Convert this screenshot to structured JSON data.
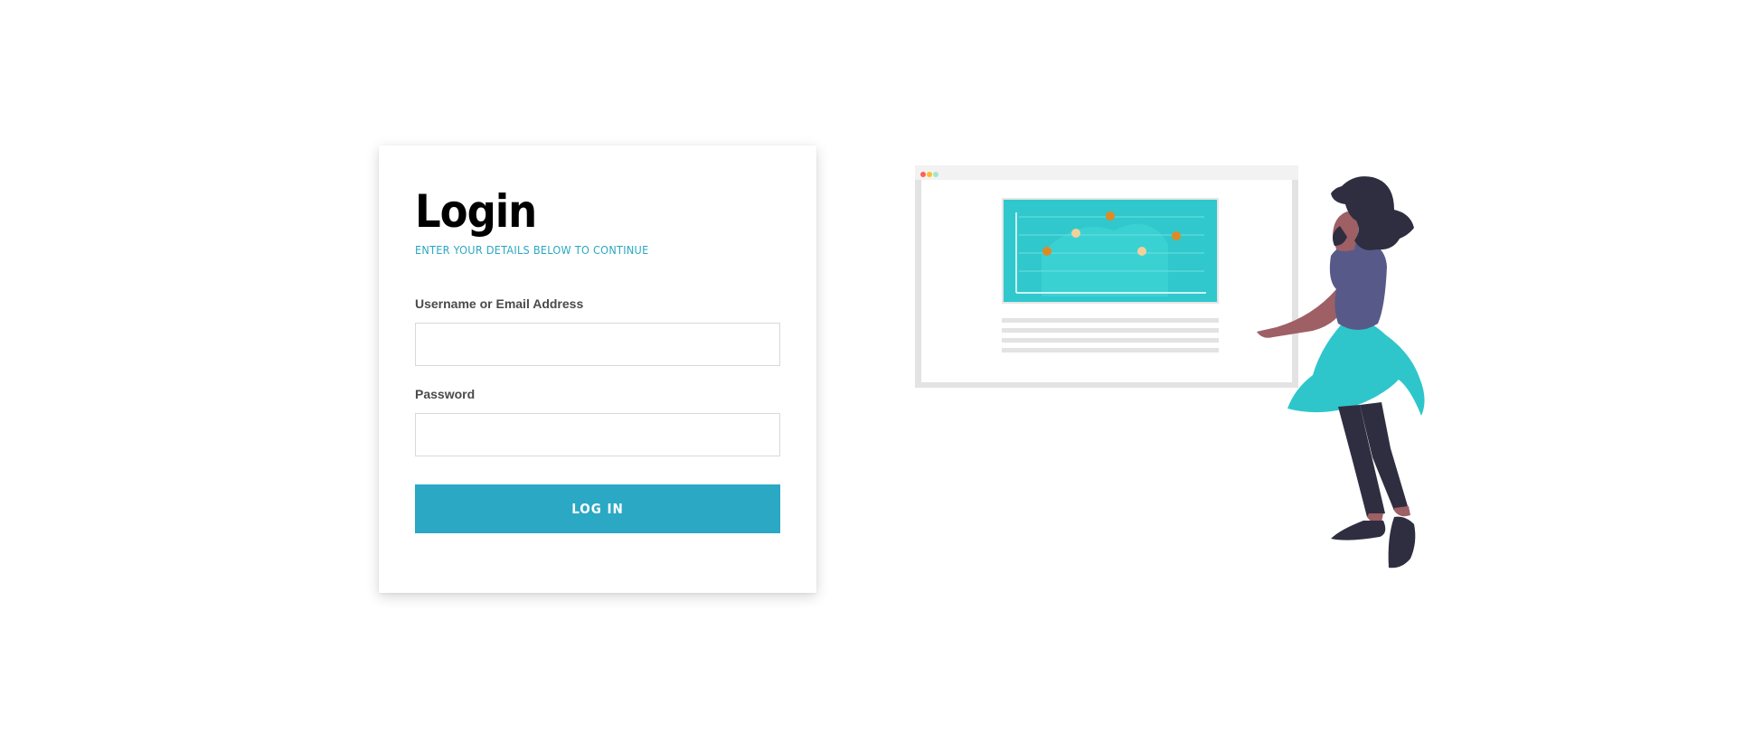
{
  "login": {
    "title": "Login",
    "subtitle": "ENTER YOUR DETAILS BELOW TO CONTINUE",
    "username_label": "Username or Email Address",
    "username_value": "",
    "password_label": "Password",
    "password_value": "",
    "submit_label": "LOG IN"
  },
  "colors": {
    "accent": "#2aa8c4",
    "screen_teal": "#30c8cc",
    "shirt": "#575a89",
    "skirt": "#2ec6cb",
    "dot_orange": "#e08a24",
    "dot_light": "#f2d09a"
  },
  "illustration": {
    "name": "person-presenting-chart",
    "window_dots": [
      "#ff5f57",
      "#febc2e",
      "#28c840"
    ]
  }
}
